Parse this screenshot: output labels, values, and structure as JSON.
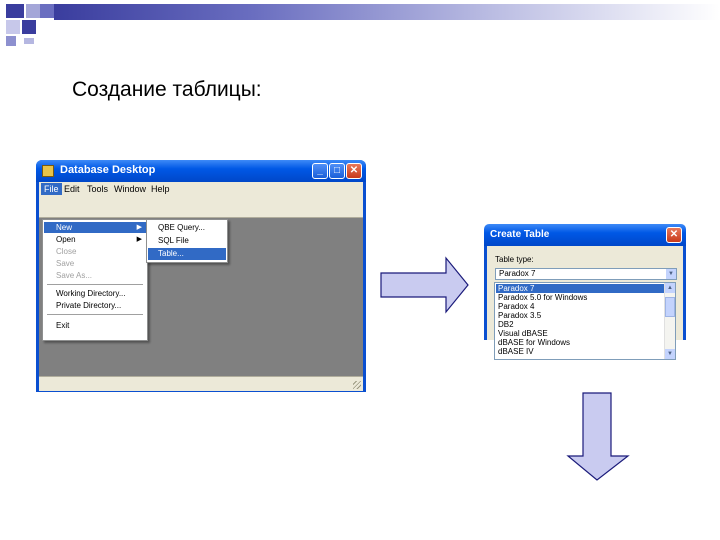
{
  "slide": {
    "title": "Создание таблицы:"
  },
  "colors": {
    "accent": "#3a3d9e",
    "arrow_fill": "#c9cbf0",
    "arrow_stroke": "#1a1a7a",
    "selection": "#316ac5"
  },
  "db_window": {
    "title": "Database Desktop",
    "caption_buttons": {
      "minimize": "_",
      "maximize": "□",
      "close": "✕"
    },
    "menubar": [
      "File",
      "Edit",
      "Tools",
      "Window",
      "Help"
    ],
    "file_menu": {
      "items": [
        {
          "label": "New",
          "submenu": true,
          "state": "selected"
        },
        {
          "label": "Open",
          "submenu": true,
          "state": "normal"
        },
        {
          "label": "Close",
          "submenu": false,
          "state": "disabled"
        },
        {
          "label": "Save",
          "submenu": false,
          "state": "disabled"
        },
        {
          "label": "Save As...",
          "submenu": false,
          "state": "disabled"
        },
        {
          "label": "Working Directory...",
          "submenu": false,
          "state": "normal"
        },
        {
          "label": "Private Directory...",
          "submenu": false,
          "state": "normal"
        },
        {
          "label": "Exit",
          "submenu": false,
          "state": "normal"
        }
      ]
    },
    "new_submenu": {
      "items": [
        {
          "label": "QBE Query...",
          "state": "normal"
        },
        {
          "label": "SQL File",
          "state": "normal"
        },
        {
          "label": "Table...",
          "state": "selected"
        }
      ]
    }
  },
  "create_table_dialog": {
    "title": "Create Table",
    "close_label": "✕",
    "field_label": "Table type:",
    "selected_value": "Paradox 7",
    "options": [
      "Paradox 7",
      "Paradox 5.0 for Windows",
      "Paradox 4",
      "Paradox 3.5",
      "DB2",
      "Visual dBASE",
      "dBASE for Windows",
      "dBASE IV"
    ]
  }
}
